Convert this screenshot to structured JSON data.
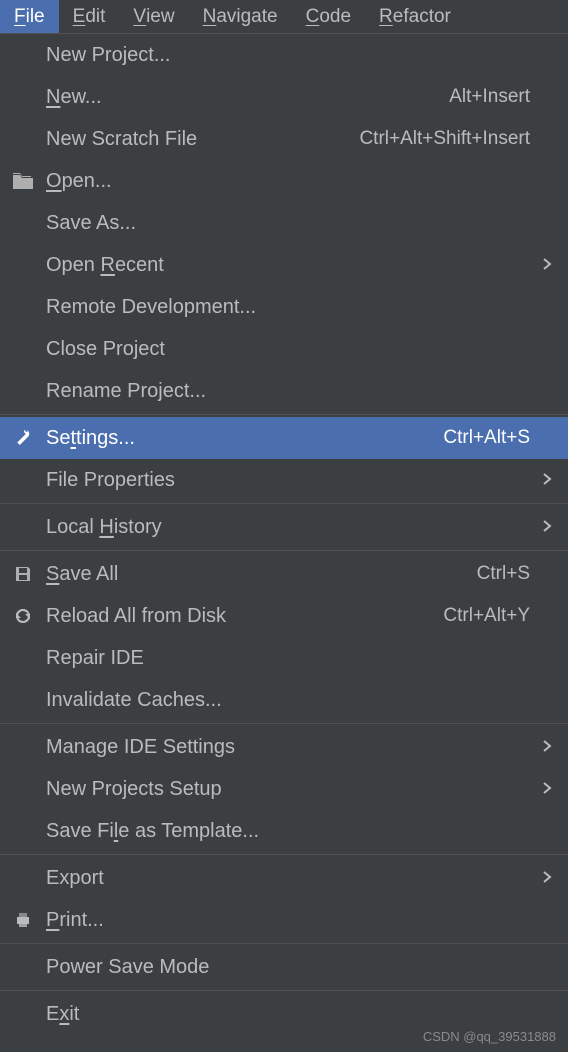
{
  "menubar": [
    {
      "label": "File",
      "mn": "F",
      "active": true
    },
    {
      "label": "Edit",
      "mn": "E"
    },
    {
      "label": "View",
      "mn": "V"
    },
    {
      "label": "Navigate",
      "mn": "N"
    },
    {
      "label": "Code",
      "mn": "C"
    },
    {
      "label": "Refactor",
      "mn": "R"
    }
  ],
  "menu": [
    {
      "type": "item",
      "name": "new-project",
      "label": "New Project...",
      "mn": ""
    },
    {
      "type": "item",
      "name": "new",
      "label": "New...",
      "mn": "N",
      "shortcut": "Alt+Insert"
    },
    {
      "type": "item",
      "name": "new-scratch-file",
      "label": "New Scratch File",
      "shortcut": "Ctrl+Alt+Shift+Insert"
    },
    {
      "type": "item",
      "name": "open",
      "label": "Open...",
      "mn": "O",
      "icon": "folder"
    },
    {
      "type": "item",
      "name": "save-as",
      "label": "Save As..."
    },
    {
      "type": "item",
      "name": "open-recent",
      "label": "Open Recent",
      "mn": "R",
      "submenu": true
    },
    {
      "type": "item",
      "name": "remote-development",
      "label": "Remote Development..."
    },
    {
      "type": "item",
      "name": "close-project",
      "label": "Close Project"
    },
    {
      "type": "item",
      "name": "rename-project",
      "label": "Rename Project..."
    },
    {
      "type": "sep"
    },
    {
      "type": "item",
      "name": "settings",
      "label": "Settings...",
      "mn": "t",
      "shortcut": "Ctrl+Alt+S",
      "icon": "wrench",
      "highlighted": true
    },
    {
      "type": "item",
      "name": "file-properties",
      "label": "File Properties",
      "submenu": true
    },
    {
      "type": "sep"
    },
    {
      "type": "item",
      "name": "local-history",
      "label": "Local History",
      "mn": "H",
      "submenu": true
    },
    {
      "type": "sep"
    },
    {
      "type": "item",
      "name": "save-all",
      "label": "Save All",
      "mn": "S",
      "shortcut": "Ctrl+S",
      "icon": "save"
    },
    {
      "type": "item",
      "name": "reload-from-disk",
      "label": "Reload All from Disk",
      "shortcut": "Ctrl+Alt+Y",
      "icon": "reload"
    },
    {
      "type": "item",
      "name": "repair-ide",
      "label": "Repair IDE"
    },
    {
      "type": "item",
      "name": "invalidate-caches",
      "label": "Invalidate Caches..."
    },
    {
      "type": "sep"
    },
    {
      "type": "item",
      "name": "manage-ide-settings",
      "label": "Manage IDE Settings",
      "submenu": true
    },
    {
      "type": "item",
      "name": "new-projects-setup",
      "label": "New Projects Setup",
      "submenu": true
    },
    {
      "type": "item",
      "name": "save-file-as-template",
      "label": "Save File as Template...",
      "mn": "l"
    },
    {
      "type": "sep"
    },
    {
      "type": "item",
      "name": "export",
      "label": "Export",
      "submenu": true
    },
    {
      "type": "item",
      "name": "print",
      "label": "Print...",
      "mn": "P",
      "icon": "print"
    },
    {
      "type": "sep"
    },
    {
      "type": "item",
      "name": "power-save-mode",
      "label": "Power Save Mode"
    },
    {
      "type": "sep"
    },
    {
      "type": "item",
      "name": "exit",
      "label": "Exit",
      "mn": "x"
    }
  ],
  "watermark": "CSDN @qq_39531888"
}
